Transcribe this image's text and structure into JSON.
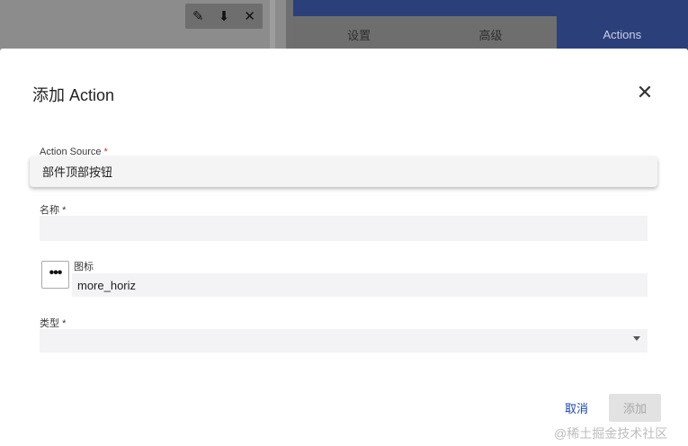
{
  "background": {
    "toolbar": {
      "edit_icon": "✎",
      "download_icon": "⬇",
      "close_icon": "✕"
    },
    "tabs": [
      {
        "label": "设置"
      },
      {
        "label": "高级"
      },
      {
        "label": "Actions"
      }
    ]
  },
  "dialog": {
    "title": "添加 Action",
    "close_icon": "✕",
    "action_source": {
      "label": "Action Source",
      "required_mark": "*",
      "value": "部件顶部按钮"
    },
    "name": {
      "label": "名称",
      "required_mark": "*",
      "value": ""
    },
    "icon": {
      "label": "图标",
      "value": "more_horiz",
      "preview": "•••"
    },
    "type": {
      "label": "类型",
      "required_mark": "*",
      "value": ""
    },
    "buttons": {
      "cancel": "取消",
      "add": "添加"
    }
  },
  "watermark": "@稀土掘金技术社区"
}
